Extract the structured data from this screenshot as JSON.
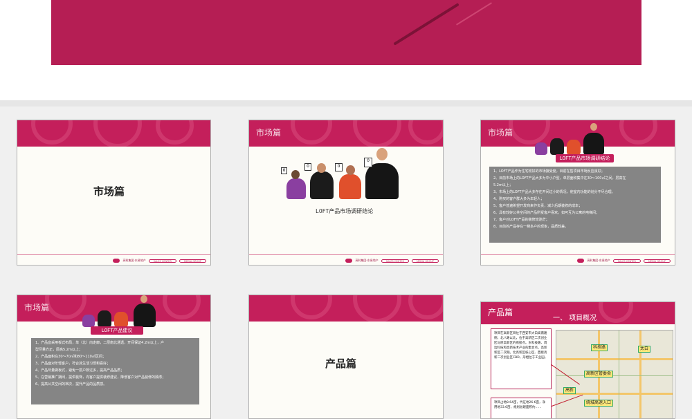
{
  "slides": {
    "s1": {
      "title": "市场篇"
    },
    "s2": {
      "band": "市场篇",
      "subtitle": "LOFT产品市场调研结论",
      "cards": [
        "0",
        "0",
        "0",
        "0"
      ]
    },
    "s3": {
      "band": "市场篇",
      "banner": "LOFT产品市场调研结论",
      "items": [
        "1、LOFT产品作为住宅较好的市场接受度，目前在售项目市场反应良好；",
        "2、目前市场上的LOFT产品大多为中小户型，单层面积集中在30～100㎡之间，层高在",
        "   5.2m以上；",
        "3、市场上的LOFT产品大多存在开间过小的情况，使室内功能的划分不尽合理。",
        "4、购买的客户群大多为年轻人；",
        "5、客户普遍希望开发商来作负责，减少后期装修的成本；",
        "6、具有较好公共空间的产品所受客户喜欢，如可互为公寓的电梯间；",
        "7、客户对LOFT产品的装修较迷茫；",
        "8、目前的产品存在一梯多户的现象，品质较差。"
      ]
    },
    "s4": {
      "band": "市场篇",
      "banner": "LOFT产品建议",
      "items": [
        "1、产品宜采用板式布局，单（北）向走廊，二层南北通透，开间保证4.2m以上，户",
        "   型尽量方正，层高5.2m以上；",
        "2、产品面积在30～70㎡和80～110㎡区间；",
        "3、产品面对年轻客户，符合其生活习惯和喜好；",
        "4、产品尽量做板式，避免一层户数过多，提高产品品质；",
        "5、在营销推广期间，提供装饰，向客户提供装修建议，降低客户对产品装修的顾虑；",
        "6、提高公共空间的档次，提升产品的品质感。"
      ]
    },
    "s5": {
      "title": "产品篇"
    },
    "s6": {
      "band": "产品篇",
      "heading": "一、 项目概况",
      "text1": "项目在高新区目位于西安市大白高南路侧，北八路以北，位于高新区二次创业区与原高新区的衔接点。东科技路、周边科技和高新技术产业的集合点。高新新区二次期。北高新区核心区、西接高新二次创业区CBD，形相位于工业园。",
      "text2": "项目占地8.64亩，代征地26.6亩，净用地33.6亩，规划总建面积约……",
      "map_labels": [
        "科技路",
        "太白",
        "高新区管委会",
        "绕城高速入口",
        "高新"
      ]
    }
  },
  "footer": {
    "company": "高科集团·东易地产",
    "pill1": "SALES CENTER",
    "pill2": "MEDIA GROUP"
  },
  "colors": {
    "brand": "#c41f5b",
    "gray_box": "#858585"
  }
}
